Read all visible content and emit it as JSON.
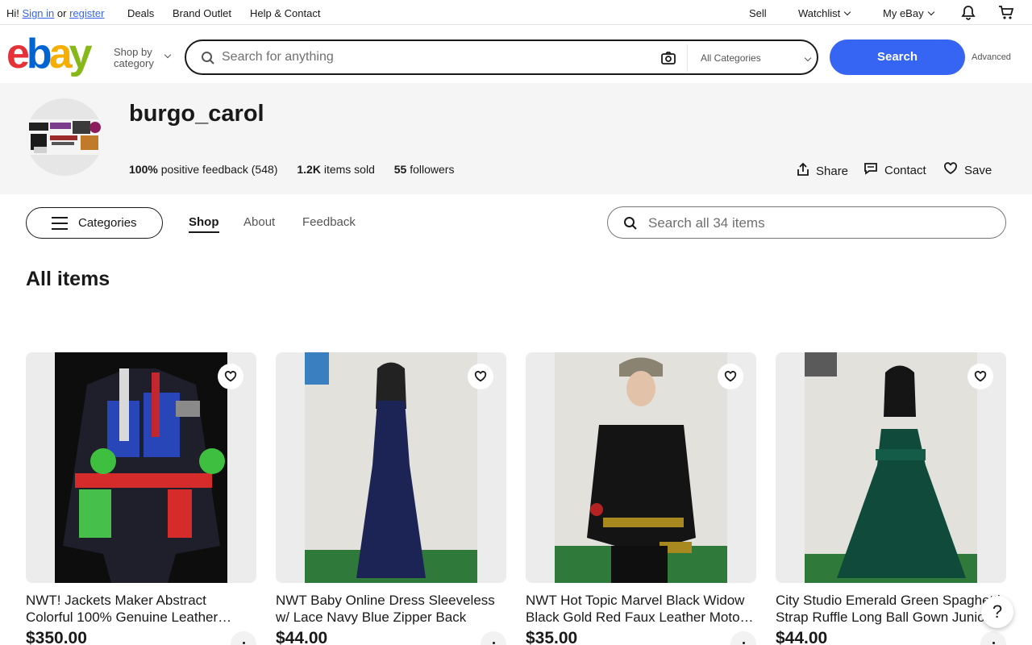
{
  "topbar": {
    "greeting": "Hi!",
    "signin": "Sign in",
    "or": "or",
    "register": "register",
    "deals": "Deals",
    "brand_outlet": "Brand Outlet",
    "help": "Help & Contact",
    "sell": "Sell",
    "watchlist": "Watchlist",
    "myebay": "My eBay"
  },
  "header": {
    "logo": [
      "e",
      "b",
      "a",
      "y"
    ],
    "shop_by_line1": "Shop by",
    "shop_by_line2": "category",
    "search_placeholder": "Search for anything",
    "category": "All Categories",
    "search_button": "Search",
    "advanced": "Advanced"
  },
  "seller": {
    "name": "burgo_carol",
    "feedback_value": "100%",
    "feedback_text": "positive feedback (548)",
    "sold_value": "1.2K",
    "sold_text": "items sold",
    "followers_value": "55",
    "followers_text": "followers",
    "share": "Share",
    "contact": "Contact",
    "save": "Save"
  },
  "store_nav": {
    "categories": "Categories",
    "tabs": [
      "Shop",
      "About",
      "Feedback"
    ],
    "search_placeholder": "Search all 34 items"
  },
  "section_title": "All items",
  "listings": [
    {
      "title": "NWT! Jackets Maker Abstract Colorful 100% Genuine Leather…",
      "price": "$350.00"
    },
    {
      "title": "NWT Baby Online Dress Sleeveless w/ Lace Navy Blue Zipper Back Lon…",
      "price": "$44.00"
    },
    {
      "title": "NWT Hot Topic Marvel Black Widow Black Gold Red Faux Leather Moto…",
      "price": "$35.00"
    },
    {
      "title": "City Studio Emerald Green Spaghetti Strap Ruffle Long Ball Gown Junio…",
      "price": "$44.00"
    }
  ],
  "help_button": "?",
  "colors": {
    "accent": "#3665f3",
    "banner_bg": "#f5f5f5"
  }
}
